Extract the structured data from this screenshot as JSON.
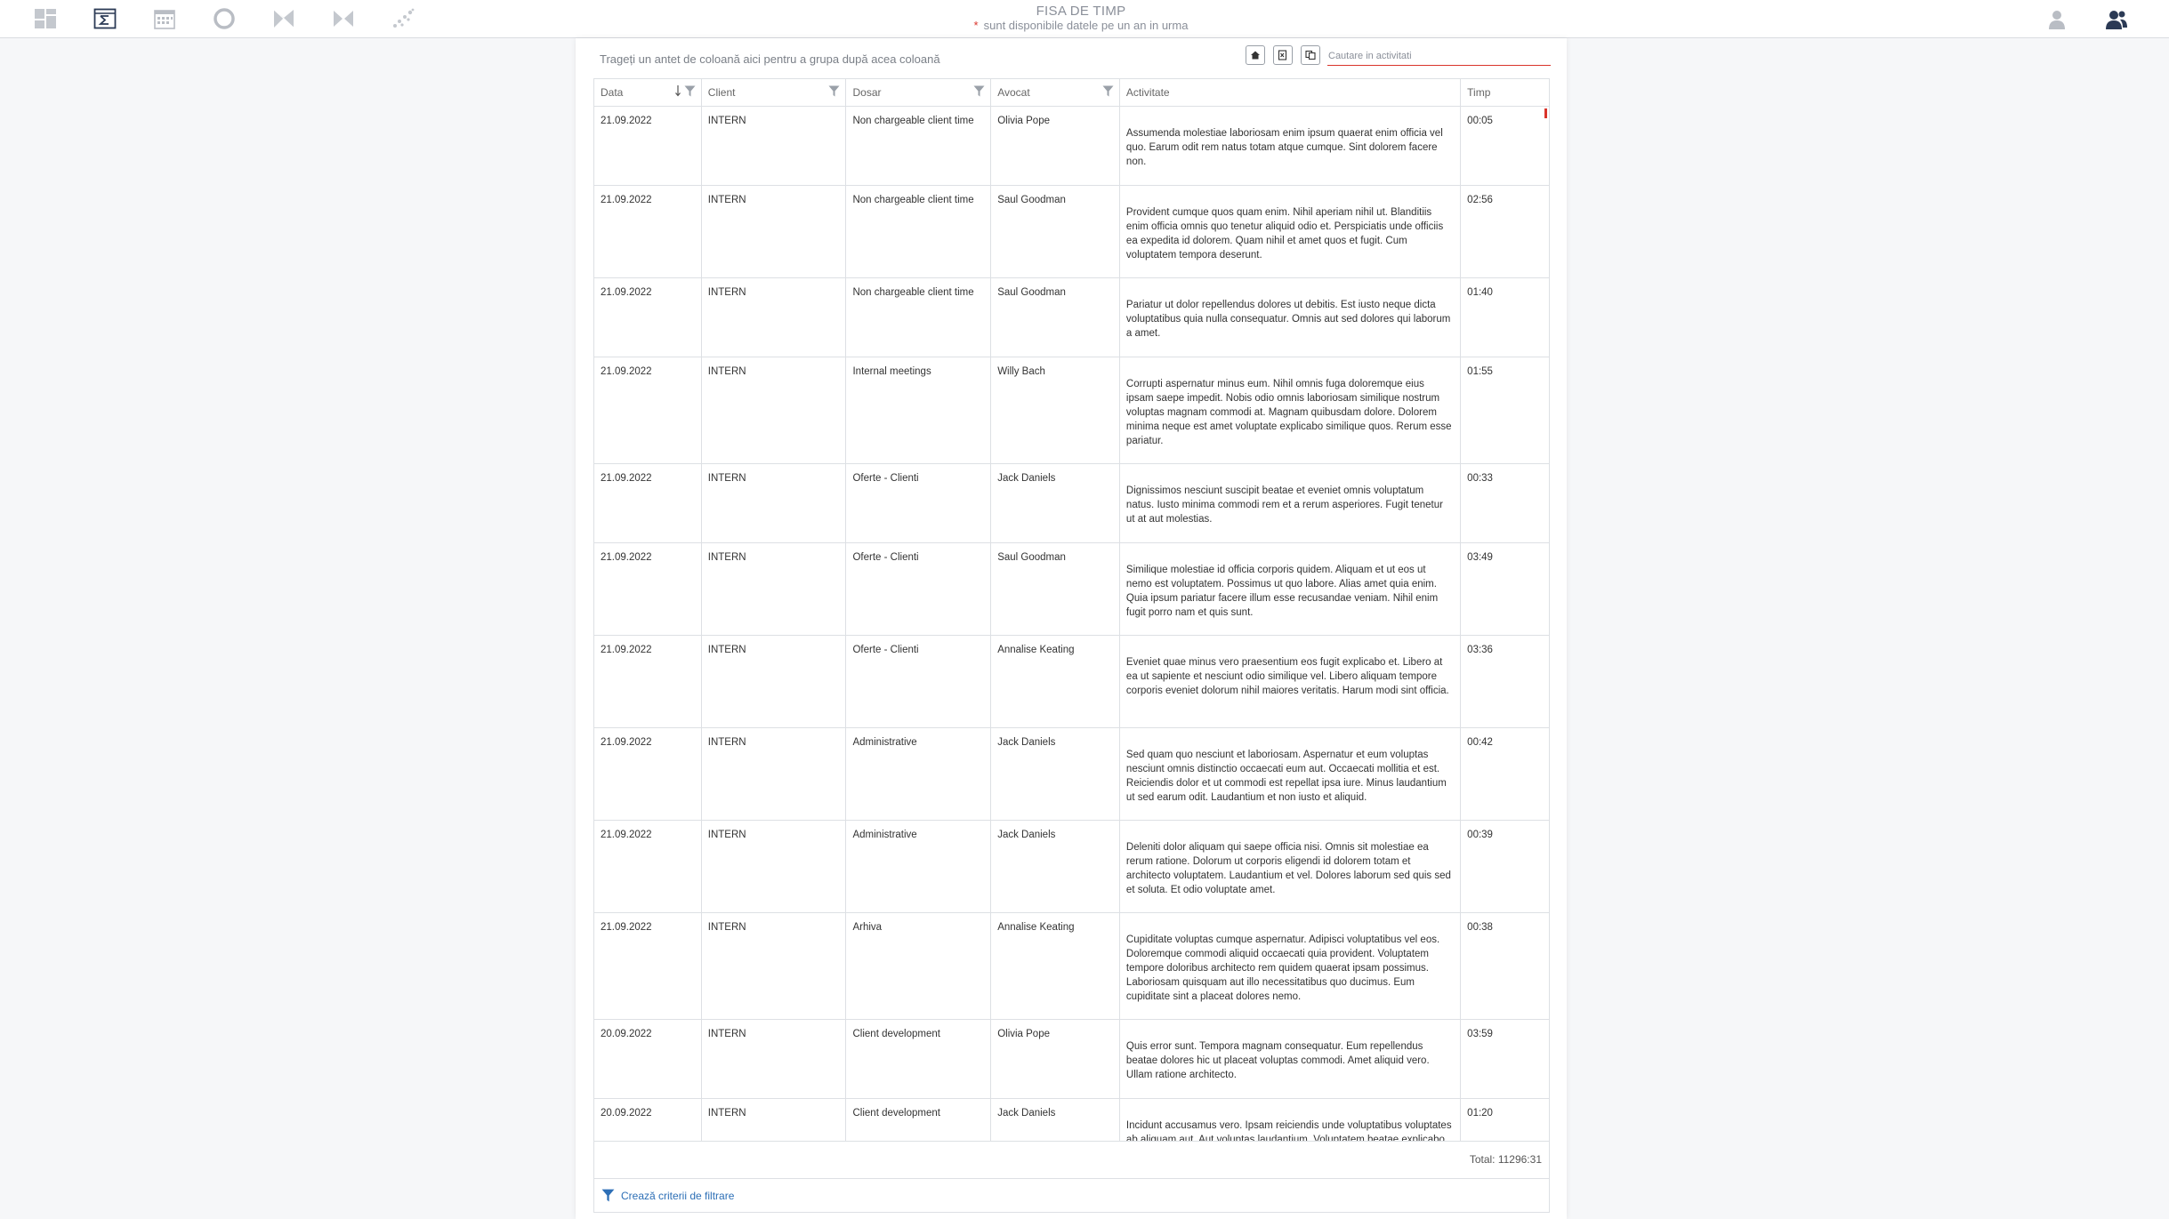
{
  "header": {
    "title": "FISA DE TIMP",
    "subtitle_star": "*",
    "subtitle": "sunt disponibile datele pe un an in urma",
    "nav_icons": [
      "dashboard-icon",
      "sum-report-icon",
      "calendar-icon",
      "donut-chart-icon",
      "butterfly-chart-icon",
      "butterfly-chart-alt-icon",
      "scatter-icon"
    ],
    "user_icons": [
      "user-icon",
      "users-icon"
    ]
  },
  "toolbar": {
    "group_hint": "Trageți un antet de coloană aici pentru a grupa după acea coloană",
    "search_placeholder": "Cautare in activitati",
    "buttons": [
      "home-icon",
      "export-excel-icon",
      "copy-icon"
    ]
  },
  "grid": {
    "columns": [
      "Data",
      "Client",
      "Dosar",
      "Avocat",
      "Activitate",
      "Timp"
    ],
    "rows": [
      {
        "data": "21.09.2022",
        "client": "INTERN",
        "dosar": "Non chargeable client time",
        "avocat": "Olivia Pope",
        "activitate": "Assumenda molestiae laboriosam enim ipsum quaerat enim officia vel quo. Earum odit rem natus totam atque cumque. Sint dolorem facere non.",
        "timp": "00:05"
      },
      {
        "data": "21.09.2022",
        "client": "INTERN",
        "dosar": "Non chargeable client time",
        "avocat": "Saul Goodman",
        "activitate": "Provident cumque quos quam enim. Nihil aperiam nihil ut. Blanditiis enim officia omnis quo tenetur aliquid odio et. Perspiciatis unde officiis ea expedita id dolorem. Quam nihil et amet quos et fugit. Cum voluptatem tempora deserunt.",
        "timp": "02:56"
      },
      {
        "data": "21.09.2022",
        "client": "INTERN",
        "dosar": "Non chargeable client time",
        "avocat": "Saul Goodman",
        "activitate": "Pariatur ut dolor repellendus dolores ut debitis. Est iusto neque dicta voluptatibus quia nulla consequatur. Omnis aut sed dolores qui laborum a amet.",
        "timp": "01:40"
      },
      {
        "data": "21.09.2022",
        "client": "INTERN",
        "dosar": "Internal meetings",
        "avocat": "Willy Bach",
        "activitate": "Corrupti aspernatur minus eum. Nihil omnis fuga doloremque eius ipsam saepe impedit. Nobis odio omnis laboriosam similique nostrum voluptas magnam commodi at. Magnam quibusdam dolore. Dolorem minima neque est amet voluptate explicabo similique quos. Rerum esse pariatur.",
        "timp": "01:55"
      },
      {
        "data": "21.09.2022",
        "client": "INTERN",
        "dosar": "Oferte - Clienti",
        "avocat": "Jack Daniels",
        "activitate": "Dignissimos nesciunt suscipit beatae et eveniet omnis voluptatum natus. Iusto minima commodi rem et a rerum asperiores. Fugit tenetur ut at aut molestias.",
        "timp": "00:33"
      },
      {
        "data": "21.09.2022",
        "client": "INTERN",
        "dosar": "Oferte - Clienti",
        "avocat": "Saul Goodman",
        "activitate": "Similique molestiae id officia corporis quidem. Aliquam et ut eos ut nemo est voluptatem. Possimus ut quo labore. Alias amet quia enim. Quia ipsum pariatur facere illum esse recusandae veniam. Nihil enim fugit porro nam et quis sunt.",
        "timp": "03:49"
      },
      {
        "data": "21.09.2022",
        "client": "INTERN",
        "dosar": "Oferte - Clienti",
        "avocat": "Annalise Keating",
        "activitate": "Eveniet quae minus vero praesentium eos fugit explicabo et. Libero at ea ut sapiente et nesciunt odio similique vel. Libero aliquam tempore corporis eveniet dolorum nihil maiores veritatis. Harum modi sint officia.",
        "timp": "03:36"
      },
      {
        "data": "21.09.2022",
        "client": "INTERN",
        "dosar": "Administrative",
        "avocat": "Jack Daniels",
        "activitate": "Sed quam quo nesciunt et laboriosam. Aspernatur et eum voluptas nesciunt omnis distinctio occaecati eum aut. Occaecati mollitia et est. Reiciendis dolor et ut commodi est repellat ipsa iure. Minus laudantium ut sed earum odit. Laudantium et non iusto et aliquid.",
        "timp": "00:42"
      },
      {
        "data": "21.09.2022",
        "client": "INTERN",
        "dosar": "Administrative",
        "avocat": "Jack Daniels",
        "activitate": "Deleniti dolor aliquam qui saepe officia nisi. Omnis sit molestiae ea rerum ratione. Dolorum ut corporis eligendi id dolorem totam et architecto voluptatem. Laudantium et vel. Dolores laborum sed quis sed et soluta. Et odio voluptate amet.",
        "timp": "00:39"
      },
      {
        "data": "21.09.2022",
        "client": "INTERN",
        "dosar": "Arhiva",
        "avocat": "Annalise Keating",
        "activitate": "Cupiditate voluptas cumque aspernatur. Adipisci voluptatibus vel eos. Doloremque commodi aliquid occaecati quia provident. Voluptatem tempore doloribus architecto rem quidem quaerat ipsam possimus. Laboriosam quisquam aut illo necessitatibus quo ducimus. Eum cupiditate sint a placeat dolores nemo.",
        "timp": "00:38"
      },
      {
        "data": "20.09.2022",
        "client": "INTERN",
        "dosar": "Client development",
        "avocat": "Olivia Pope",
        "activitate": "Quis error sunt. Tempora magnam consequatur. Eum repellendus beatae dolores hic ut placeat voluptas commodi. Amet aliquid vero. Ullam ratione architecto.",
        "timp": "03:59"
      },
      {
        "data": "20.09.2022",
        "client": "INTERN",
        "dosar": "Client development",
        "avocat": "Jack Daniels",
        "activitate": "Incidunt accusamus vero. Ipsam reiciendis unde voluptatibus voluptates ab aliquam aut. Aut voluptas laudantium. Voluptatem beatae explicabo et eius. Commodi a autem omnis.",
        "timp": "01:20"
      }
    ],
    "total_label": "Total: 11296:31"
  },
  "footer": {
    "create_filter_label": "Crează criterii de filtrare"
  },
  "colors": {
    "accent_red": "#d9342b",
    "link_blue": "#2d6fb6",
    "icon_gray": "#9aa0a8",
    "icon_dark": "#2b3a55"
  }
}
